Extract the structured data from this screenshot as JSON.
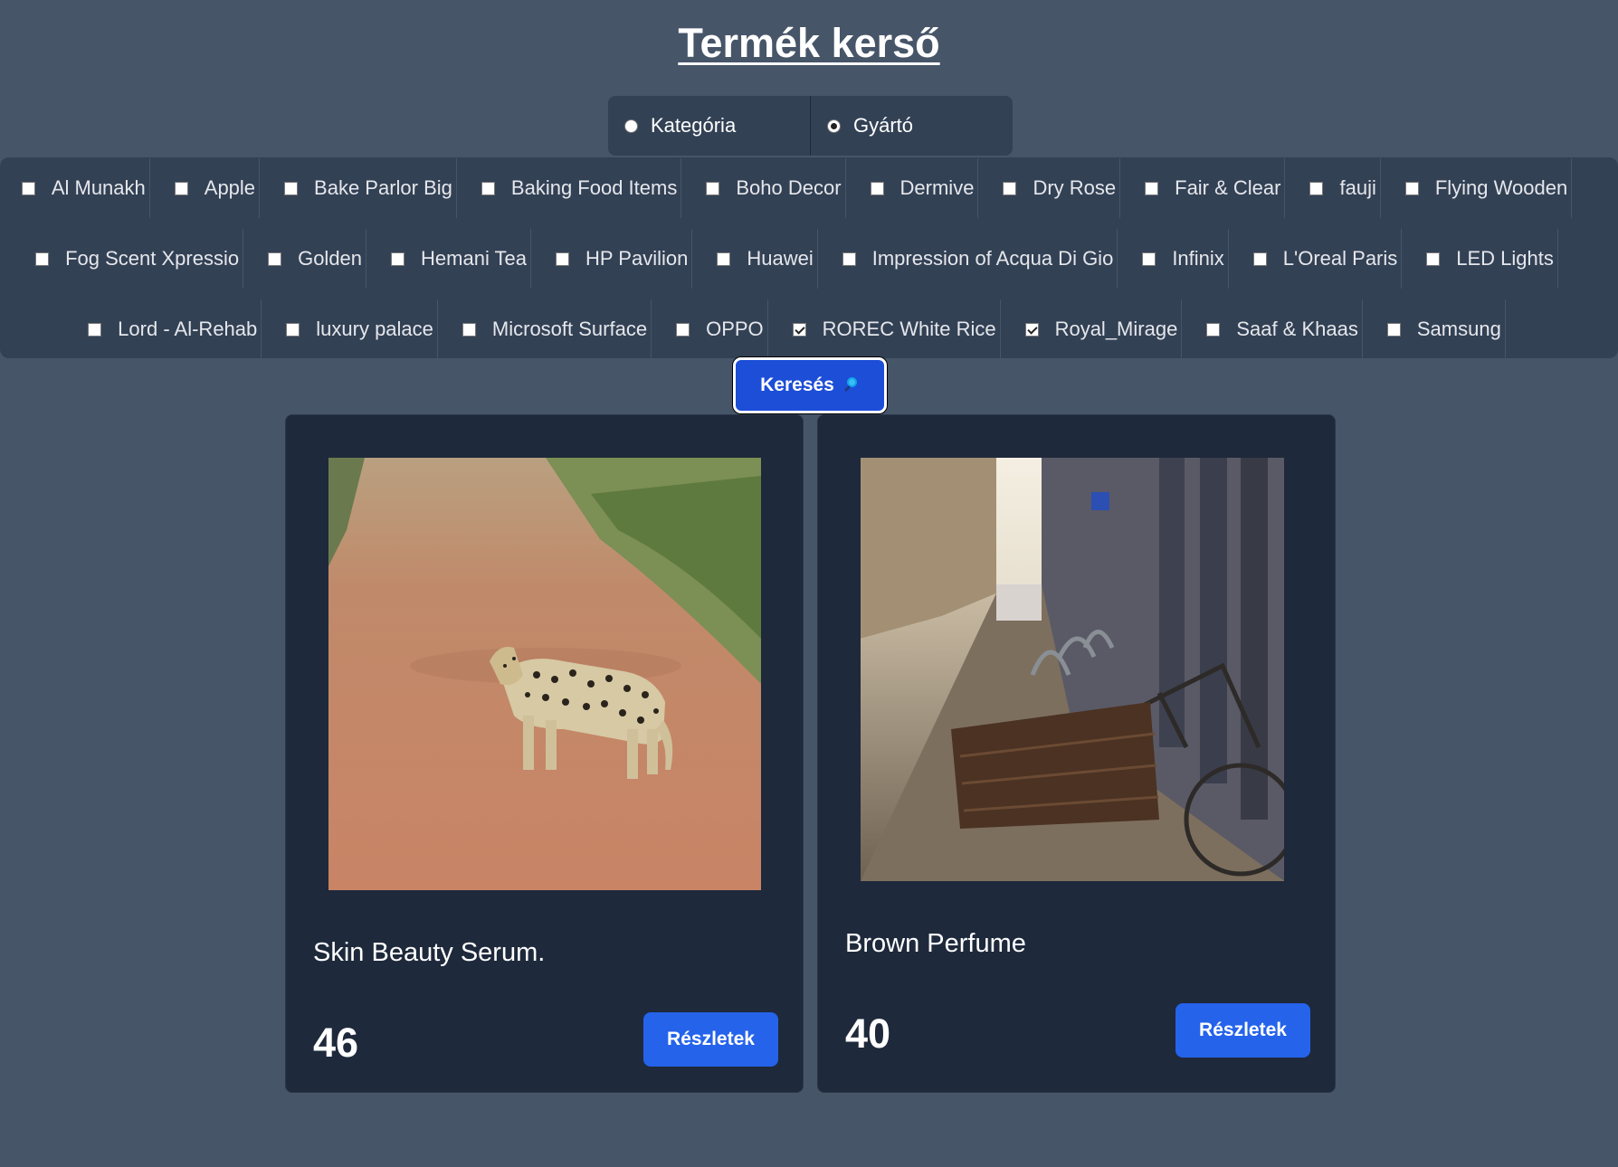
{
  "page": {
    "title": "Termék kerső"
  },
  "mode": {
    "options": [
      {
        "label": "Kategória",
        "checked": false
      },
      {
        "label": "Gyártó",
        "checked": true
      }
    ]
  },
  "filters": {
    "rows": [
      [
        {
          "label": "Al Munakh",
          "checked": false
        },
        {
          "label": "Apple",
          "checked": false
        },
        {
          "label": "Bake Parlor Big",
          "checked": false
        },
        {
          "label": "Baking Food Items",
          "checked": false
        },
        {
          "label": "Boho Decor",
          "checked": false
        },
        {
          "label": "Dermive",
          "checked": false
        },
        {
          "label": "Dry Rose",
          "checked": false
        },
        {
          "label": "Fair & Clear",
          "checked": false
        },
        {
          "label": "fauji",
          "checked": false
        },
        {
          "label": "Flying Wooden",
          "checked": false
        }
      ],
      [
        {
          "label": "Fog Scent Xpressio",
          "checked": false
        },
        {
          "label": "Golden",
          "checked": false
        },
        {
          "label": "Hemani Tea",
          "checked": false
        },
        {
          "label": "HP Pavilion",
          "checked": false
        },
        {
          "label": "Huawei",
          "checked": false
        },
        {
          "label": "Impression of Acqua Di Gio",
          "checked": false
        },
        {
          "label": "Infinix",
          "checked": false
        },
        {
          "label": "L'Oreal Paris",
          "checked": false
        },
        {
          "label": "LED Lights",
          "checked": false
        }
      ],
      [
        {
          "label": "Lord - Al-Rehab",
          "checked": false
        },
        {
          "label": "luxury palace",
          "checked": false
        },
        {
          "label": "Microsoft Surface",
          "checked": false
        },
        {
          "label": "OPPO",
          "checked": false
        },
        {
          "label": "ROREC White Rice",
          "checked": true
        },
        {
          "label": "Royal_Mirage",
          "checked": true
        },
        {
          "label": "Saaf & Khaas",
          "checked": false
        },
        {
          "label": "Samsung",
          "checked": false
        }
      ]
    ]
  },
  "search": {
    "label": "Keresés",
    "icon": "magnifier-icon"
  },
  "products": [
    {
      "name": "Skin Beauty Serum.",
      "price": "46",
      "button": "Részletek",
      "image": "leopard-on-dirt-road"
    },
    {
      "name": "Brown Perfume",
      "price": "40",
      "button": "Részletek",
      "image": "bicycle-on-city-street"
    }
  ],
  "colors": {
    "background": "#475569",
    "panel": "#334155",
    "card": "#1e293b",
    "accent": "#2563eb"
  }
}
